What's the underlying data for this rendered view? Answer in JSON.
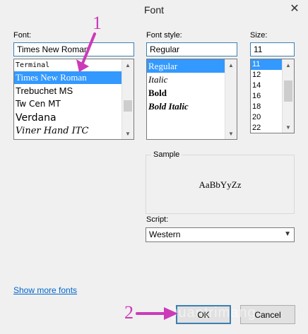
{
  "window": {
    "title": "Font"
  },
  "font": {
    "label": "Font:",
    "value": "Times New Roman",
    "items": [
      "Terminal",
      "Times New Roman",
      "Trebuchet MS",
      "Tw Cen MT",
      "Verdana",
      "Viner Hand ITC"
    ],
    "selected_index": 1
  },
  "style": {
    "label": "Font style:",
    "value": "Regular",
    "items": [
      "Regular",
      "Italic",
      "Bold",
      "Bold Italic"
    ],
    "selected_index": 0
  },
  "size": {
    "label": "Size:",
    "value": "11",
    "items": [
      "11",
      "12",
      "14",
      "16",
      "18",
      "20",
      "22"
    ],
    "selected_index": 0
  },
  "sample": {
    "label": "Sample",
    "text": "AaBbYyZz"
  },
  "script": {
    "label": "Script:",
    "value": "Western"
  },
  "links": {
    "show_more": "Show more fonts"
  },
  "buttons": {
    "ok": "OK",
    "cancel": "Cancel"
  },
  "annotations": {
    "one": "1",
    "two": "2",
    "color": "#cc3ab8"
  },
  "colors": {
    "selection": "#3399ff",
    "link": "#0066cc",
    "focus": "#3c7fb1"
  },
  "watermark": "Quantrimang"
}
